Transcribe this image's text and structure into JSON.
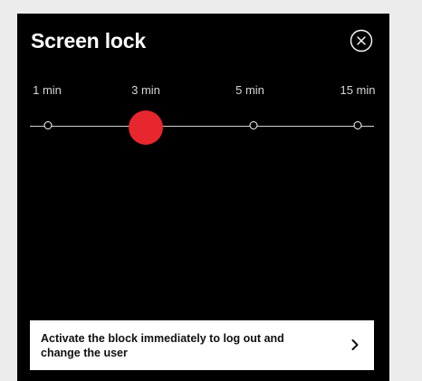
{
  "dialog": {
    "title": "Screen lock",
    "close_icon": "close-circle-icon"
  },
  "slider": {
    "options": [
      "1 min",
      "3 min",
      "5 min",
      "15 min"
    ],
    "selected_index": 1,
    "selected_value": "3 min",
    "accent_color": "#e8262d"
  },
  "action": {
    "label": "Activate the block immediately to log out and change the user",
    "icon": "chevron-right-icon"
  },
  "colors": {
    "background": "#ececec",
    "panel": "#000000",
    "card": "#ffffff",
    "accent": "#e8262d"
  }
}
